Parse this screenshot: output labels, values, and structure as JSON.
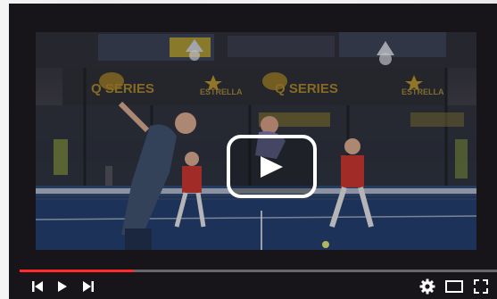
{
  "player": {
    "progress_fraction": 0.24,
    "accent_color": "#ff2a2a",
    "state": "paused",
    "controls": {
      "previous": "skip-previous-icon",
      "play": "play-icon",
      "next": "skip-next-icon",
      "settings": "gear-icon",
      "theater": "theater-mode-icon",
      "fullscreen": "fullscreen-icon"
    }
  },
  "video": {
    "banners": [
      "Q SERIES",
      "ESTRELLA",
      "Q SERIES",
      "ESTRELLA"
    ]
  }
}
